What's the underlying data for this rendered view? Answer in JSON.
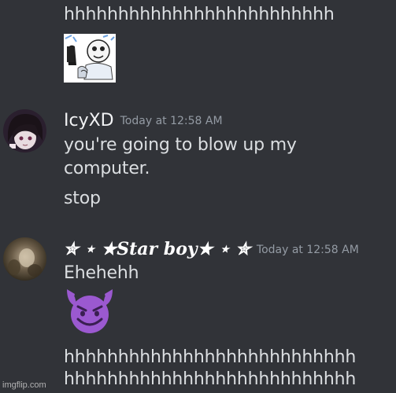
{
  "messages": {
    "top_line": "hhhhhhhhhhhhhhhhhhhhhhhhh",
    "icy": {
      "username": "IcyXD",
      "timestamp": "Today at 12:58 AM",
      "line1": "you're going to blow up my",
      "line2": "computer.",
      "line3": "stop"
    },
    "star": {
      "username_prefix": "✮ ⋆ ★",
      "username_core": "Star boy",
      "username_suffix": "★ ⋆ ✮",
      "timestamp": "Today at 12:58 AM",
      "line1": "Ehehehh",
      "line2": "hhhhhhhhhhhhhhhhhhhhhhhhhhh",
      "line3": "hhhhhhhhhhhhhhhhhhhhhhhhhhh"
    }
  },
  "watermark": "imgflip.com",
  "icons": {
    "sticker": "meme-sticker-icon",
    "emoji": "smiling-imp-emoji-icon",
    "icy_avatar": "anime-avatar-icon",
    "star_avatar": "blurry-avatar-icon"
  },
  "colors": {
    "background": "#313338",
    "text": "#dbdee1",
    "timestamp": "#949ba4",
    "emoji_purple": "#9b59d0"
  }
}
